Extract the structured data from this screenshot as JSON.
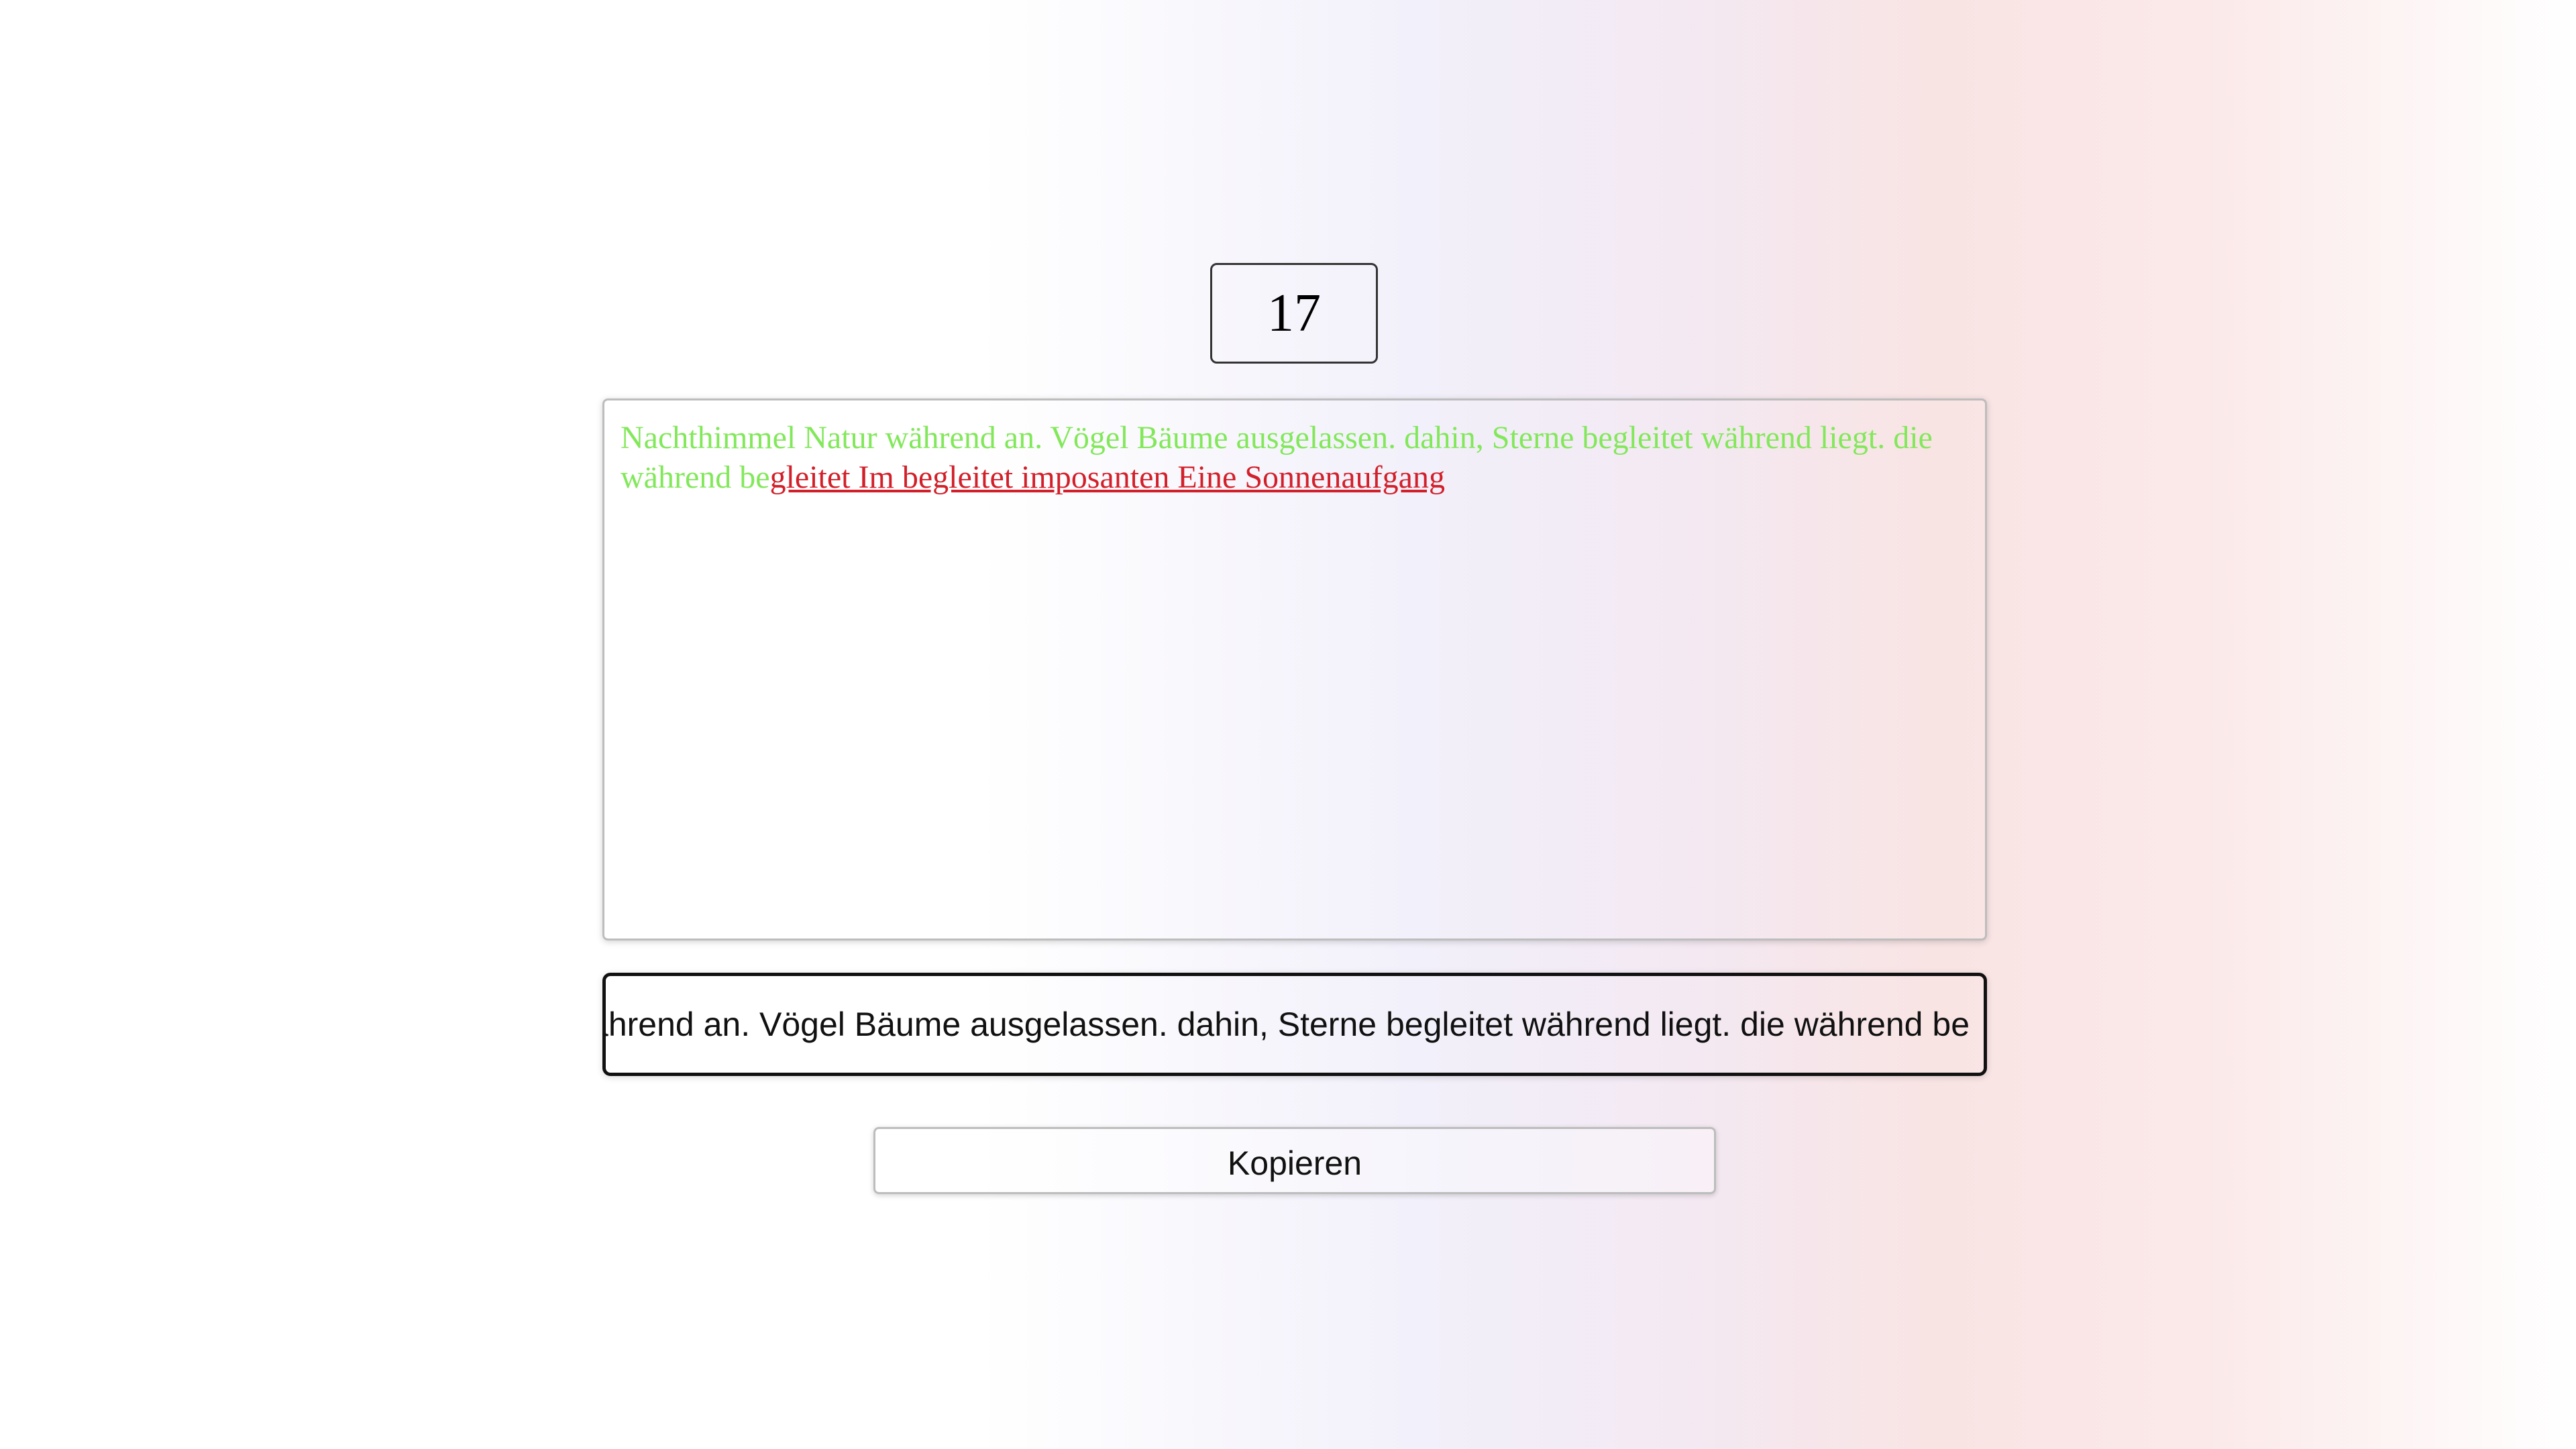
{
  "counter": {
    "value": "17"
  },
  "text_panel": {
    "typed_text": "Nachthimmel Natur während an. Vögel Bäume ausgelassen. dahin, Sterne begleitet während liegt. die während be",
    "remaining_text": "gleitet Im begleitet imposanten Eine Sonnenaufgang",
    "typed_color": "#82e85a",
    "remaining_color": "#d2202a"
  },
  "input": {
    "value": "Nachthimmel Natur während an. Vögel Bäume ausgelassen. dahin, Sterne begleitet während liegt. die während be"
  },
  "copy_button": {
    "label": "Kopieren"
  }
}
